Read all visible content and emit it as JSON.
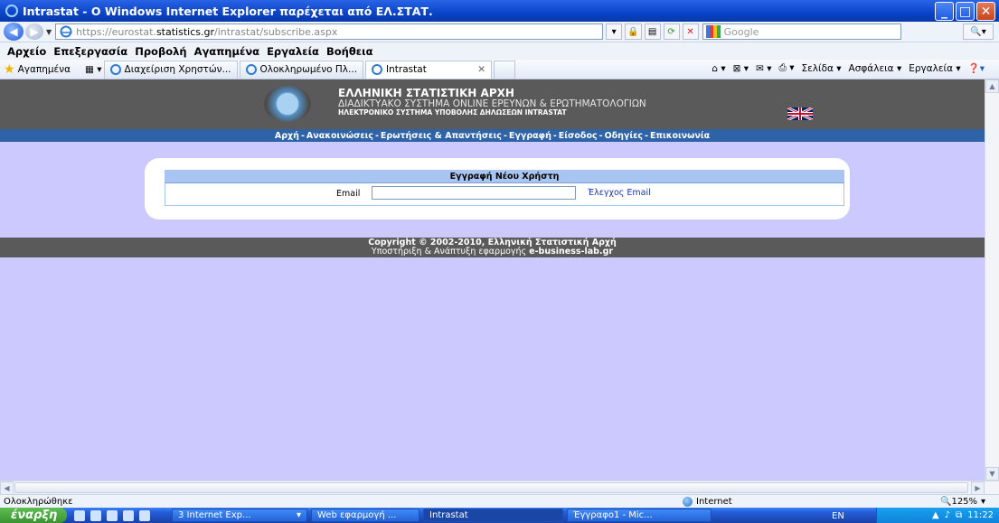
{
  "window": {
    "title": "Intrastat - O Windows Internet Explorer παρέχεται από ΕΛ.ΣΤΑΤ."
  },
  "address": {
    "prefix": "https://eurostat.",
    "domain": "statistics.gr",
    "path": "/intrastat/subscribe.aspx"
  },
  "search": {
    "placeholder": "Google"
  },
  "menu": [
    "Αρχείο",
    "Επεξεργασία",
    "Προβολή",
    "Αγαπημένα",
    "Εργαλεία",
    "Βοήθεια"
  ],
  "favorites": {
    "label": "Αγαπημένα",
    "tabs": [
      "Διαχείριση Χρηστών...",
      "Ολοκληρωμένο Πλ...",
      "Intrastat"
    ],
    "tools": [
      "Σελίδα",
      "Ασφάλεια",
      "Εργαλεία"
    ]
  },
  "banner": {
    "line1": "ΕΛΛΗΝΙΚΗ ΣΤΑΤΙΣΤΙΚΗ ΑΡΧΗ",
    "line2": "ΔΙΑΔΙΚΤΥΑΚΟ ΣΥΣΤΗΜΑ ONLINE ΕΡΕΥΝΩΝ & ΕΡΩΤΗΜΑΤΟΛΟΓΙΩΝ",
    "line3": "ΗΛΕΚΤΡΟΝΙΚΟ ΣΥΣΤΗΜΑ ΥΠΟΒΟΛΗΣ ΔΗΛΩΣΕΩΝ INTRASTAT"
  },
  "nav": {
    "links": [
      "Αρχή",
      "Ανακοινώσεις",
      "Ερωτήσεις & Απαντήσεις",
      "Εγγραφή",
      "Είσοδος",
      "Οδηγίες",
      "Επικοινωνία"
    ]
  },
  "form": {
    "title": "Εγγραφή Νέου Χρήστη",
    "email_label": "Email",
    "email_value": "",
    "check_link": "Έλεγχος Email"
  },
  "footer": {
    "copyright": "Copyright © 2002-2010, Ελληνική Στατιστική Αρχή",
    "support": "Υποστήριξη & Ανάπτυξη εφαρμογής ",
    "company": "e-business-lab.gr"
  },
  "status": {
    "text": "Ολοκληρώθηκε",
    "zone": "Internet",
    "zoom": "125%"
  },
  "taskbar": {
    "start": "έναρξη",
    "tasks": [
      "3 Internet Exp...",
      "Web εφαρμογή ...",
      "Intrastat",
      "Έγγραφο1 - Mic..."
    ],
    "lang": "EN",
    "clock": "11:22"
  },
  "colors": {
    "banner": "#5a5a5a",
    "nav": "#2e63a8",
    "content_bg": "#ccc9ff",
    "form_header": "#a8c4f0"
  }
}
